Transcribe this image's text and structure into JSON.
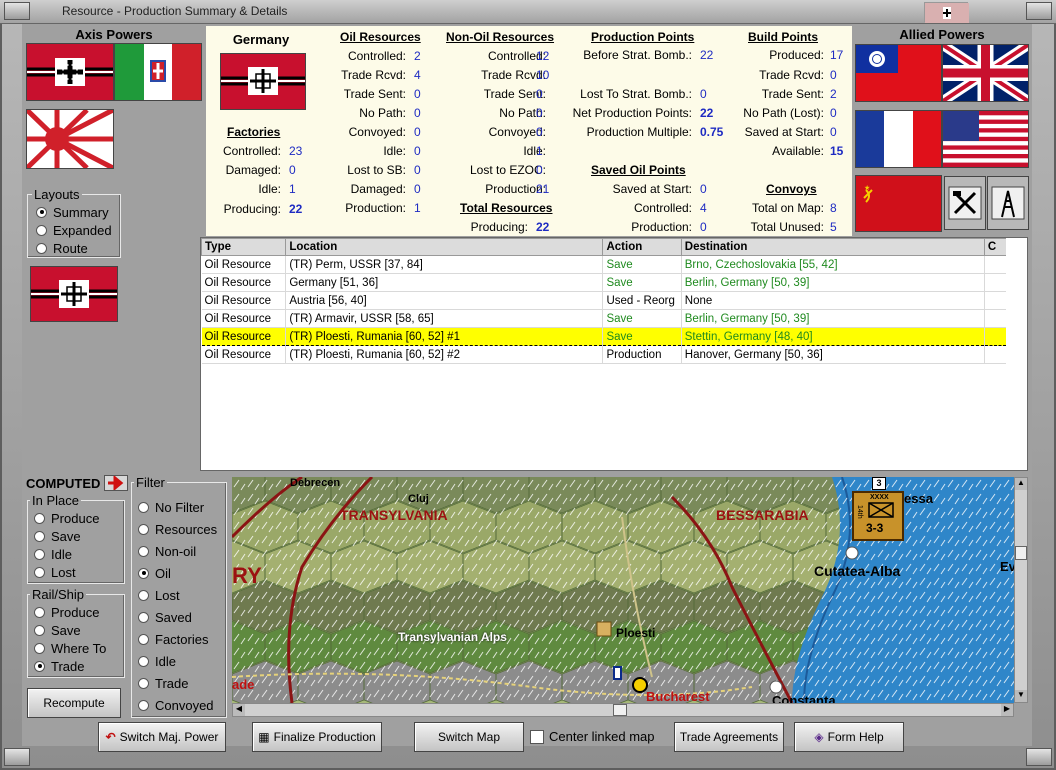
{
  "window": {
    "title": "Resource - Production Summary & Details"
  },
  "axis": {
    "header": "Axis Powers"
  },
  "allied": {
    "header": "Allied Powers"
  },
  "summary": {
    "country": "Germany",
    "factories": {
      "title": "Factories",
      "rows": [
        {
          "label": "Controlled:",
          "value": "23"
        },
        {
          "label": "Damaged:",
          "value": "0"
        },
        {
          "label": "Idle:",
          "value": "1"
        },
        {
          "label": "Producing:",
          "value": "22"
        }
      ]
    },
    "oil": {
      "title": "Oil Resources",
      "rows": [
        {
          "label": "Controlled:",
          "value": "2"
        },
        {
          "label": "Trade Rcvd:",
          "value": "4"
        },
        {
          "label": "Trade Sent:",
          "value": "0"
        },
        {
          "label": "No Path:",
          "value": "0"
        },
        {
          "label": "Convoyed:",
          "value": "0"
        },
        {
          "label": "Idle:",
          "value": "0"
        },
        {
          "label": "Lost to SB:",
          "value": "0"
        },
        {
          "label": "Damaged:",
          "value": "0"
        },
        {
          "label": "Production:",
          "value": "1"
        }
      ]
    },
    "nonoil": {
      "title": "Non-Oil Resources",
      "rows": [
        {
          "label": "Controlled:",
          "value": "12"
        },
        {
          "label": "Trade Rcvd:",
          "value": "10"
        },
        {
          "label": "Trade Sent:",
          "value": "0"
        },
        {
          "label": "No Path:",
          "value": "0"
        },
        {
          "label": "Convoyed:",
          "value": "0"
        },
        {
          "label": "Idle:",
          "value": "1"
        },
        {
          "label": "Lost to EZOC:",
          "value": "0"
        },
        {
          "label": "Production:",
          "value": "21"
        }
      ]
    },
    "total": {
      "title": "Total Resources",
      "label": "Producing:",
      "value": "22"
    },
    "pp": {
      "title": "Production Points",
      "before_label": "Before Strat. Bomb.:",
      "before_value": "22",
      "lost_label": "Lost To Strat. Bomb.:",
      "lost_value": "0",
      "net_label": "Net Production Points:",
      "net_value": "22",
      "mult_label": "Production Multiple:",
      "mult_value": "0.75"
    },
    "savedoil": {
      "title": "Saved Oil Points",
      "rows": [
        {
          "label": "Saved at Start:",
          "value": "0"
        },
        {
          "label": "Controlled:",
          "value": "4"
        },
        {
          "label": "Production:",
          "value": "0"
        }
      ]
    },
    "bp": {
      "title": "Build Points",
      "rows": [
        {
          "label": "Produced:",
          "value": "17"
        },
        {
          "label": "Trade Rcvd:",
          "value": "0"
        },
        {
          "label": "Trade Sent:",
          "value": "2"
        },
        {
          "label": "No Path (Lost):",
          "value": "0"
        },
        {
          "label": "Saved at Start:",
          "value": "0"
        },
        {
          "label": "Available:",
          "value": "15"
        }
      ]
    },
    "convoys": {
      "title": "Convoys",
      "rows": [
        {
          "label": "Total on Map:",
          "value": "8"
        },
        {
          "label": "Total Unused:",
          "value": "5"
        }
      ]
    }
  },
  "layouts": {
    "label": "Layouts",
    "options": [
      "Summary",
      "Expanded",
      "Route"
    ],
    "selected": "Summary"
  },
  "table": {
    "headers": [
      "Type",
      "Location",
      "Action",
      "Destination",
      "C"
    ],
    "rows": [
      {
        "type": "Oil Resource",
        "location": "(TR) Perm, USSR [37, 84]",
        "action": "Save",
        "destination": "Brno, Czechoslovakia [55, 42]",
        "green": true,
        "selected": false
      },
      {
        "type": "Oil Resource",
        "location": "Germany [51, 36]",
        "action": "Save",
        "destination": "Berlin, Germany [50, 39]",
        "green": true,
        "selected": false
      },
      {
        "type": "Oil Resource",
        "location": "Austria [56, 40]",
        "action": "Used - Reorg",
        "destination": "None",
        "green": false,
        "selected": false
      },
      {
        "type": "Oil Resource",
        "location": "(TR) Armavir, USSR [58, 65]",
        "action": "Save",
        "destination": "Berlin, Germany [50, 39]",
        "green": true,
        "selected": false
      },
      {
        "type": "Oil Resource",
        "location": "(TR) Ploesti, Rumania [60, 52] #1",
        "action": "Save",
        "destination": "Stettin, Germany [48, 40]",
        "green": true,
        "selected": true
      },
      {
        "type": "Oil Resource",
        "location": "(TR) Ploesti, Rumania [60, 52] #2",
        "action": "Production",
        "destination": "Hanover, Germany [50, 36]",
        "green": false,
        "selected": false
      }
    ]
  },
  "computed": {
    "label": "COMPUTED",
    "inplace": {
      "label": "In Place",
      "options": [
        "Produce",
        "Save",
        "Idle",
        "Lost"
      ]
    },
    "railship": {
      "label": "Rail/Ship",
      "options": [
        "Produce",
        "Save",
        "Where To",
        "Trade"
      ],
      "selected": "Trade"
    },
    "recompute": "Recompute"
  },
  "filter": {
    "label": "Filter",
    "options": [
      "No Filter",
      "Resources",
      "Non-oil",
      "Oil",
      "Lost",
      "Saved",
      "Factories",
      "Idle",
      "Trade",
      "Convoyed"
    ],
    "selected": "Oil"
  },
  "map": {
    "labels": {
      "debrecen": "Debrecen",
      "cluj": "Cluj",
      "transylvania": "TRANSYLVANIA",
      "bessarabia": "BESSARABIA",
      "ry": "RY",
      "cutatea": "Cutatea-Alba",
      "alps": "Transylvanian Alps",
      "ploesti": "Ploesti",
      "bucharest": "Bucharest",
      "constanta": "Constanta",
      "ade": "ade",
      "essa": "essa",
      "ev": "Ev"
    },
    "unit": {
      "top": "XXXX",
      "side": "14th",
      "strength": "3-3",
      "stack": "3"
    }
  },
  "bottom": {
    "switch_power": "Switch Maj. Power",
    "finalize": "Finalize Production",
    "switch_map": "Switch Map",
    "center_linked": "Center linked map",
    "trade_agreements": "Trade Agreements",
    "form_help": "Form Help"
  }
}
